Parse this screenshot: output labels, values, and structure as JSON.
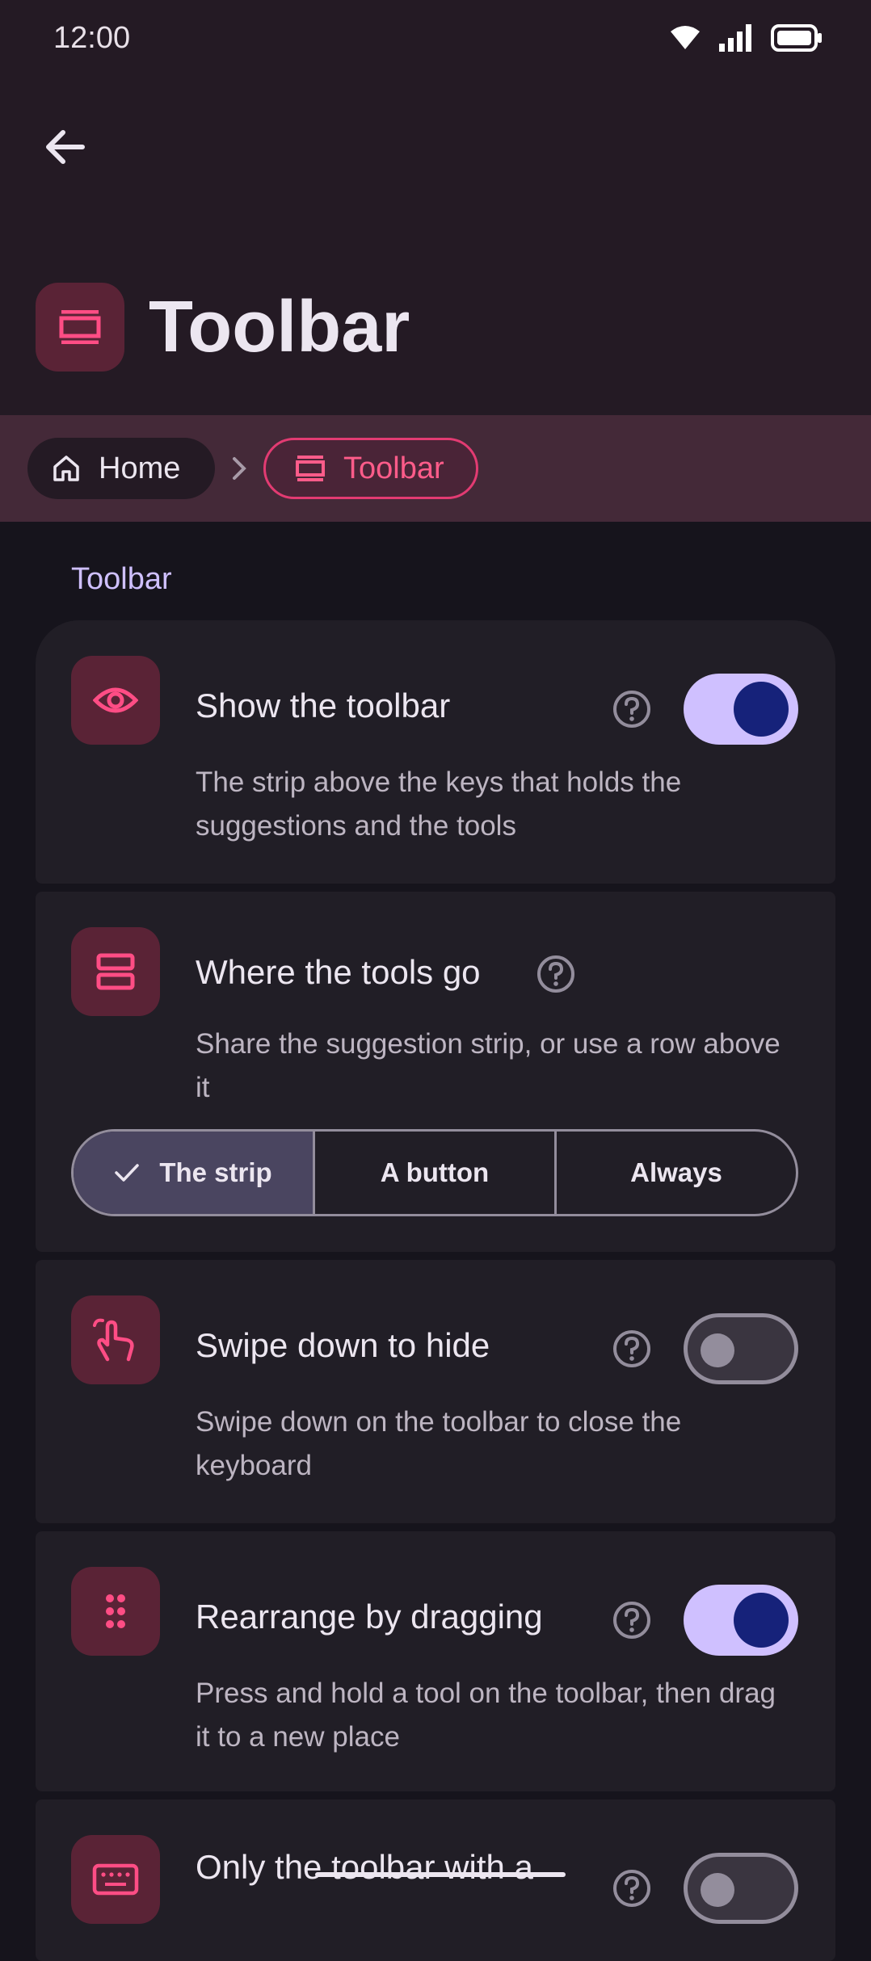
{
  "status_bar": {
    "time": "12:00"
  },
  "header": {
    "title": "Toolbar"
  },
  "breadcrumb": {
    "home": "Home",
    "current": "Toolbar"
  },
  "section": {
    "title": "Toolbar"
  },
  "settings": [
    {
      "label": "Show the toolbar",
      "description": "The strip above the keys that holds the suggestions and the tools",
      "toggle": true
    },
    {
      "label": "Where the tools go",
      "description": "Share the suggestion strip, or use a row above it",
      "options": [
        "The strip",
        "A button",
        "Always"
      ],
      "selected": "The strip"
    },
    {
      "label": "Swipe down to hide",
      "description": "Swipe down on the toolbar to close the keyboard",
      "toggle": false
    },
    {
      "label": "Rearrange by dragging",
      "description": "Press and hold a tool on the toolbar, then drag it to a new place",
      "toggle": true
    },
    {
      "label": "Only the toolbar with a",
      "toggle": false
    }
  ],
  "colors": {
    "accent": "#e23b72",
    "toggle_on": "#cfc0ff",
    "section_title": "#cfc0ff"
  }
}
